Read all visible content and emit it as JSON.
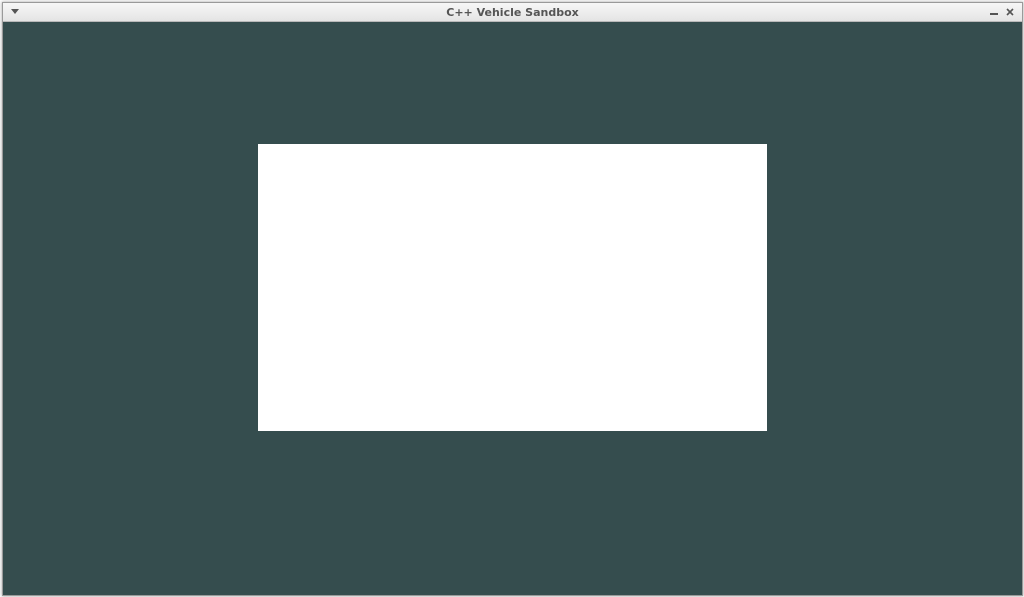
{
  "window": {
    "title": "C++ Vehicle Sandbox",
    "icons": {
      "menu": "chevron-down-icon",
      "minimize": "minimize-icon",
      "close": "close-icon"
    }
  },
  "colors": {
    "background": "#354d4e",
    "canvas_rect": "#ffffff",
    "titlebar": "#ececec",
    "title_text": "#555555"
  }
}
